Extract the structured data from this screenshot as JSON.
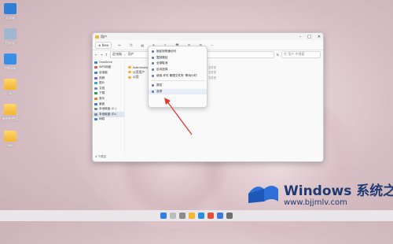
{
  "desktop": {
    "icons": [
      {
        "label": "此电脑",
        "icon": "computer-icon",
        "color": "#2f7fd6"
      },
      {
        "label": "回收站",
        "icon": "recycle-bin-icon",
        "color": "#9fb7cf"
      },
      {
        "label": "控制面板",
        "icon": "control-panel-icon",
        "color": "#3a8ee6"
      },
      {
        "label": "lin",
        "icon": "folder-icon",
        "color": "#f2b632"
      },
      {
        "label": "有限的使用",
        "icon": "folder-icon",
        "color": "#f2b632"
      },
      {
        "label": "abc",
        "icon": "folder-icon",
        "color": "#f2b632"
      }
    ]
  },
  "explorer": {
    "title": "用户",
    "toolbar": {
      "new_label": "New"
    },
    "address": {
      "path": [
        "此电脑",
        "用户"
      ],
      "search_placeholder": "在 用户 中搜索"
    },
    "nav_items": [
      {
        "label": "OneDrive",
        "icon": "onedrive-icon",
        "color": "#3b7fd4",
        "selected": false
      },
      {
        "label": "WPS网盘",
        "icon": "cloud-icon",
        "color": "#d9534f",
        "selected": false
      },
      {
        "label": "此电脑",
        "icon": "computer-icon",
        "color": "#3b7fd4",
        "selected": false
      },
      {
        "label": "视频",
        "icon": "video-icon",
        "color": "#7a5ccc",
        "selected": false
      },
      {
        "label": "图片",
        "icon": "pictures-icon",
        "color": "#3ba3d4",
        "selected": false
      },
      {
        "label": "文档",
        "icon": "documents-icon",
        "color": "#6c8ebf",
        "selected": false
      },
      {
        "label": "下载",
        "icon": "download-icon",
        "color": "#2e9d5b",
        "selected": false
      },
      {
        "label": "音乐",
        "icon": "music-icon",
        "color": "#e3762f",
        "selected": false
      },
      {
        "label": "桌面",
        "icon": "desktop-icon",
        "color": "#3b7fd4",
        "selected": false
      },
      {
        "label": "本地磁盘 (C:)",
        "icon": "drive-icon",
        "color": "#7a8896",
        "selected": false
      },
      {
        "label": "本地磁盘 (D:)",
        "icon": "drive-icon",
        "color": "#7a8896",
        "selected": true
      },
      {
        "label": "网络",
        "icon": "network-icon",
        "color": "#3b7fd4",
        "selected": false
      }
    ],
    "files": [
      {
        "name": "Administrator",
        "type": "文件夹"
      },
      {
        "name": "公用用户",
        "type": "文件夹"
      },
      {
        "name": "公用",
        "type": "文件夹"
      }
    ],
    "status": "4 个项目"
  },
  "context_menu": {
    "items": [
      {
        "label": "固定到快速访问",
        "icon": "pin-icon"
      },
      {
        "label": "复制路径",
        "icon": "copy-path-icon"
      },
      {
        "label": "全部取消",
        "icon": "select-none-icon"
      },
      {
        "label": "反向选择",
        "icon": "invert-icon"
      },
      {
        "label": "使用 许可 管理文件夹 '等待小时'",
        "icon": "shield-icon"
      },
      {
        "label": "属性",
        "icon": "properties-icon"
      },
      {
        "label": "选项",
        "icon": "options-icon"
      }
    ],
    "highlighted_index": 6
  },
  "watermark": {
    "title": "Windows 系统之家",
    "url": "www.bjjmlv.com"
  },
  "colors": {
    "accent": "#1f3a72",
    "arrow": "#e0382b"
  }
}
